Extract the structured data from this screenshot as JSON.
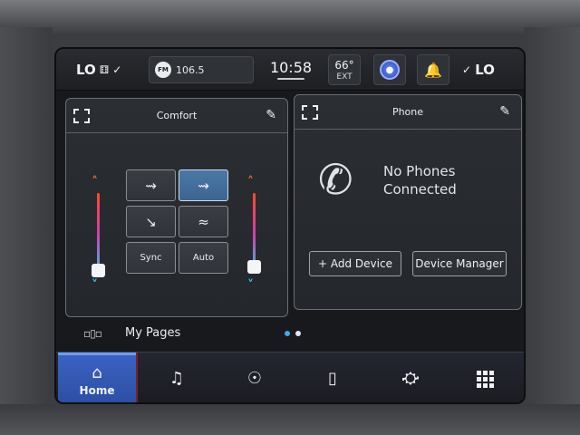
{
  "status_bar": {
    "driver_temp": "LO",
    "radio": {
      "band": "FM",
      "frequency": "106.5"
    },
    "time": "10:58",
    "outside_temp": {
      "value": "66°",
      "label": "EXT"
    },
    "passenger_temp": "LO"
  },
  "comfort_card": {
    "title": "Comfort",
    "modes": [
      {
        "icon": "seat-airflow-face-icon",
        "active": false
      },
      {
        "icon": "seat-airflow-face-feet-icon",
        "active": true
      },
      {
        "icon": "seat-airflow-feet-icon",
        "active": false
      },
      {
        "icon": "seat-airflow-defrost-feet-icon",
        "active": false
      }
    ],
    "sync_label": "Sync",
    "auto_label": "Auto",
    "left_temp_level": 0,
    "right_temp_level": 0
  },
  "phone_card": {
    "title": "Phone",
    "status_line1": "No Phones",
    "status_line2": "Connected",
    "add_device_label": "+ Add Device",
    "device_manager_label": "Device Manager"
  },
  "my_pages": {
    "label": "My Pages",
    "page_count": 2,
    "current_page": 1
  },
  "nav": {
    "home_label": "Home",
    "items": [
      "home",
      "media",
      "climate",
      "phone",
      "vehicle",
      "apps"
    ]
  },
  "colors": {
    "accent_blue": "#3a63c2",
    "active_mode": "#4b78a6",
    "heat": "#f06a2a",
    "cool": "#3fc3f0"
  }
}
